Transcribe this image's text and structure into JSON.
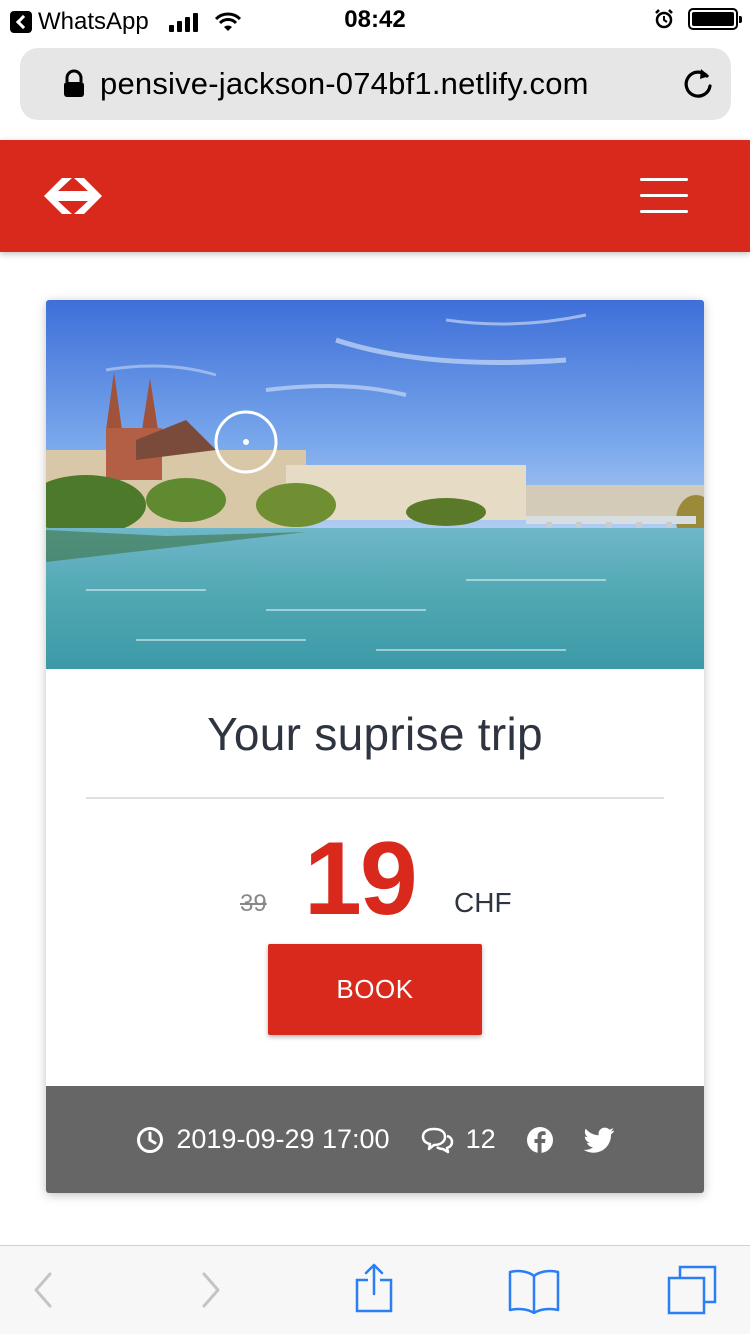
{
  "status_bar": {
    "back_app": "WhatsApp",
    "time": "08:42"
  },
  "browser": {
    "url": "pensive-jackson-074bf1.netlify.com"
  },
  "header": {
    "brand_color": "#d9291c"
  },
  "card": {
    "title": "Your suprise trip",
    "old_price": "39",
    "price": "19",
    "currency": "CHF",
    "book_label": "BOOK",
    "footer": {
      "datetime": "2019-09-29 17:00",
      "comments": "12"
    },
    "icons": [
      "clock-icon",
      "comments-icon",
      "facebook-icon",
      "twitter-icon"
    ]
  },
  "toolbar": {
    "icons": [
      "back-arrow-icon",
      "forward-arrow-icon",
      "share-icon",
      "bookmarks-icon",
      "tabs-icon"
    ]
  }
}
